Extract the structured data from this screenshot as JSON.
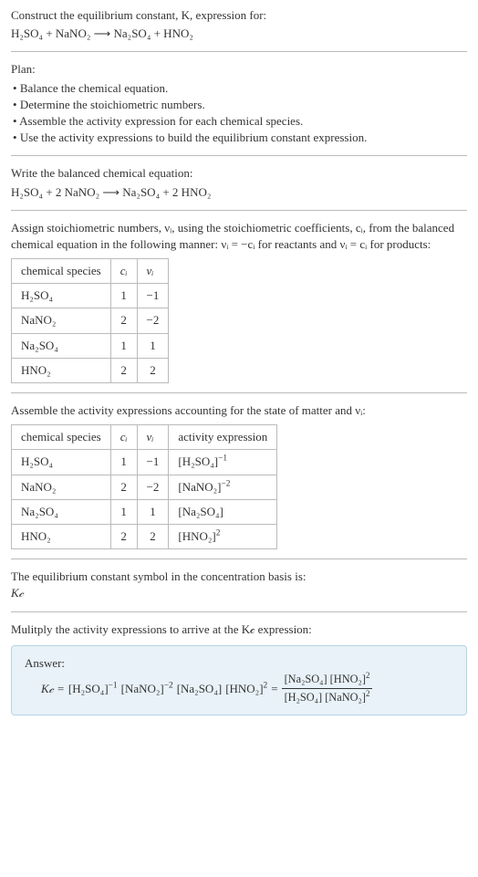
{
  "intro": {
    "line1": "Construct the equilibrium constant, K, expression for:",
    "equation": "H₂SO₄ + NaNO₂ ⟶ Na₂SO₄ + HNO₂"
  },
  "plan": {
    "heading": "Plan:",
    "items": [
      "Balance the chemical equation.",
      "Determine the stoichiometric numbers.",
      "Assemble the activity expression for each chemical species.",
      "Use the activity expressions to build the equilibrium constant expression."
    ]
  },
  "balanced": {
    "heading": "Write the balanced chemical equation:",
    "equation": "H₂SO₄ + 2 NaNO₂ ⟶ Na₂SO₄ + 2 HNO₂"
  },
  "stoich_intro": "Assign stoichiometric numbers, νᵢ, using the stoichiometric coefficients, cᵢ, from the balanced chemical equation in the following manner: νᵢ = −cᵢ for reactants and νᵢ = cᵢ for products:",
  "table1": {
    "headers": [
      "chemical species",
      "cᵢ",
      "νᵢ"
    ],
    "rows": [
      {
        "species": "H₂SO₄",
        "c": "1",
        "v": "−1"
      },
      {
        "species": "NaNO₂",
        "c": "2",
        "v": "−2"
      },
      {
        "species": "Na₂SO₄",
        "c": "1",
        "v": "1"
      },
      {
        "species": "HNO₂",
        "c": "2",
        "v": "2"
      }
    ]
  },
  "activity_intro": "Assemble the activity expressions accounting for the state of matter and νᵢ:",
  "table2": {
    "headers": [
      "chemical species",
      "cᵢ",
      "νᵢ",
      "activity expression"
    ],
    "rows": [
      {
        "species": "H₂SO₄",
        "c": "1",
        "v": "−1",
        "expr_base": "[H₂SO₄]",
        "expr_pow": "−1"
      },
      {
        "species": "NaNO₂",
        "c": "2",
        "v": "−2",
        "expr_base": "[NaNO₂]",
        "expr_pow": "−2"
      },
      {
        "species": "Na₂SO₄",
        "c": "1",
        "v": "1",
        "expr_base": "[Na₂SO₄]",
        "expr_pow": ""
      },
      {
        "species": "HNO₂",
        "c": "2",
        "v": "2",
        "expr_base": "[HNO₂]",
        "expr_pow": "2"
      }
    ]
  },
  "kc_symbol": {
    "line1": "The equilibrium constant symbol in the concentration basis is:",
    "symbol": "K𝒸"
  },
  "multiply_line": "Mulitply the activity expressions to arrive at the K𝒸 expression:",
  "answer": {
    "label": "Answer:",
    "kc": "K𝒸 = ",
    "t1_base": "[H₂SO₄]",
    "t1_pow": "−1",
    "t2_base": "[NaNO₂]",
    "t2_pow": "−2",
    "t3_base": "[Na₂SO₄]",
    "t4_base": "[HNO₂]",
    "t4_pow": "2",
    "eq": " = ",
    "num_a": "[Na₂SO₄]",
    "num_b_base": "[HNO₂]",
    "num_b_pow": "2",
    "den_a": "[H₂SO₄]",
    "den_b_base": "[NaNO₂]",
    "den_b_pow": "2"
  },
  "chart_data": {
    "type": "table",
    "tables": [
      {
        "columns": [
          "chemical species",
          "cᵢ",
          "νᵢ"
        ],
        "rows": [
          [
            "H₂SO₄",
            1,
            -1
          ],
          [
            "NaNO₂",
            2,
            -2
          ],
          [
            "Na₂SO₄",
            1,
            1
          ],
          [
            "HNO₂",
            2,
            2
          ]
        ]
      },
      {
        "columns": [
          "chemical species",
          "cᵢ",
          "νᵢ",
          "activity expression"
        ],
        "rows": [
          [
            "H₂SO₄",
            1,
            -1,
            "[H₂SO₄]^−1"
          ],
          [
            "NaNO₂",
            2,
            -2,
            "[NaNO₂]^−2"
          ],
          [
            "Na₂SO₄",
            1,
            1,
            "[Na₂SO₄]"
          ],
          [
            "HNO₂",
            2,
            2,
            "[HNO₂]^2"
          ]
        ]
      }
    ]
  }
}
